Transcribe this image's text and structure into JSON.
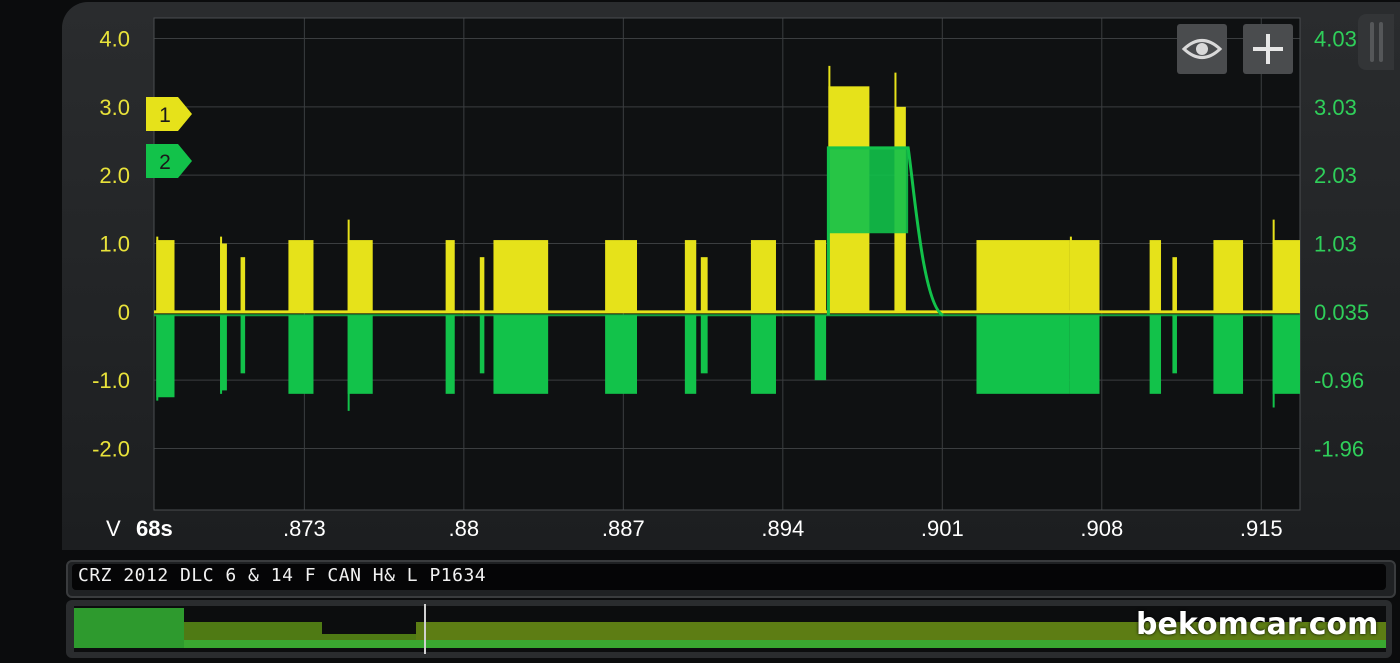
{
  "colors": {
    "channel1": "#e6e21a",
    "channel2": "#12c24a",
    "background": "#0b0c0d",
    "grid": "#3b3e40",
    "axis_text_left": "#e8e23a",
    "axis_text_right": "#2fcf5a",
    "time_text": "#ffffff"
  },
  "toolbar": {
    "view_icon": "eye-icon",
    "add_icon": "plus-icon"
  },
  "markers": {
    "ch1_label": "1",
    "ch2_label": "2"
  },
  "caption": "CRZ 2012 DLC 6 & 14 F CAN H& L P1634",
  "watermark": "bekomcar.com",
  "chart_data": {
    "type": "line",
    "unit_label": "V",
    "time_start_label": "68s",
    "x_ticks": [
      ".873",
      ".88",
      ".887",
      ".894",
      ".901",
      ".908",
      ".915"
    ],
    "x_tick_values": [
      68.873,
      68.88,
      68.887,
      68.894,
      68.901,
      68.908,
      68.915
    ],
    "xlim": [
      68.8664,
      68.9167
    ],
    "y_left_ticks": [
      "4.0",
      "3.0",
      "2.0",
      "1.0",
      "0",
      "-1.0",
      "-2.0"
    ],
    "y_left_values": [
      4.0,
      3.0,
      2.0,
      1.0,
      0,
      -1.0,
      -2.0
    ],
    "y_right_ticks": [
      "4.03",
      "3.03",
      "2.03",
      "1.03",
      "0.035",
      "-0.96",
      "-1.96"
    ],
    "ylim": [
      -2.9,
      4.3
    ],
    "grid": true,
    "series": [
      {
        "name": "1",
        "marker_label": "1",
        "baseline": 0,
        "dominant_level": 1.05,
        "note_level": "bursts from 0 V up to ~1 V, peaks to ~3.6 V near .897",
        "bursts": [
          {
            "t0": 68.8665,
            "t1": 68.8673,
            "high": 1.05,
            "spike": 1.1
          },
          {
            "t0": 68.8693,
            "t1": 68.8696,
            "high": 1.0,
            "spike": 1.1
          },
          {
            "t0": 68.8702,
            "t1": 68.8704,
            "high": 0.8,
            "spike": 0.8
          },
          {
            "t0": 68.8723,
            "t1": 68.8734,
            "high": 1.05,
            "spike": 1.05
          },
          {
            "t0": 68.8749,
            "t1": 68.876,
            "high": 1.05,
            "spike": 1.35
          },
          {
            "t0": 68.8792,
            "t1": 68.8796,
            "high": 1.05,
            "spike": 1.05
          },
          {
            "t0": 68.8807,
            "t1": 68.8809,
            "high": 0.8,
            "spike": 0.8
          },
          {
            "t0": 68.8813,
            "t1": 68.8837,
            "high": 1.05,
            "spike": 1.05
          },
          {
            "t0": 68.8862,
            "t1": 68.8876,
            "high": 1.05,
            "spike": 1.05
          },
          {
            "t0": 68.8897,
            "t1": 68.8902,
            "high": 1.05,
            "spike": 1.05
          },
          {
            "t0": 68.8904,
            "t1": 68.8907,
            "high": 0.8,
            "spike": 0.8
          },
          {
            "t0": 68.8926,
            "t1": 68.8937,
            "high": 1.05,
            "spike": 1.05
          },
          {
            "t0": 68.8954,
            "t1": 68.8959,
            "high": 1.05,
            "spike": 1.05
          },
          {
            "t0": 68.896,
            "t1": 68.8978,
            "high": 3.3,
            "spike": 3.6
          },
          {
            "t0": 68.8989,
            "t1": 68.8994,
            "high": 3.0,
            "spike": 3.5
          },
          {
            "t0": 68.9025,
            "t1": 68.9066,
            "high": 1.05,
            "spike": 1.05
          },
          {
            "t0": 68.9066,
            "t1": 68.9079,
            "high": 1.05,
            "spike": 1.1
          },
          {
            "t0": 68.9101,
            "t1": 68.9106,
            "high": 1.05,
            "spike": 1.05
          },
          {
            "t0": 68.9111,
            "t1": 68.9113,
            "high": 0.8,
            "spike": 0.8
          },
          {
            "t0": 68.9129,
            "t1": 68.9142,
            "high": 1.05,
            "spike": 1.05
          },
          {
            "t0": 68.9155,
            "t1": 68.9167,
            "high": 1.05,
            "spike": 1.35
          }
        ]
      },
      {
        "name": "2",
        "marker_label": "2",
        "baseline": -0.05,
        "dominant_level": -1.2,
        "note_level": "bursts from 0 V down to ~-1.2 V, plateau ~2.4 V near .897-.900",
        "bursts": [
          {
            "t0": 68.8665,
            "t1": 68.8673,
            "low": -1.25,
            "spike": -1.3
          },
          {
            "t0": 68.8693,
            "t1": 68.8696,
            "low": -1.15,
            "spike": -1.2
          },
          {
            "t0": 68.8702,
            "t1": 68.8704,
            "low": -0.9,
            "spike": -0.9
          },
          {
            "t0": 68.8723,
            "t1": 68.8734,
            "low": -1.2,
            "spike": -1.2
          },
          {
            "t0": 68.8749,
            "t1": 68.876,
            "low": -1.2,
            "spike": -1.45
          },
          {
            "t0": 68.8792,
            "t1": 68.8796,
            "low": -1.2,
            "spike": -1.2
          },
          {
            "t0": 68.8807,
            "t1": 68.8809,
            "low": -0.9,
            "spike": -0.9
          },
          {
            "t0": 68.8813,
            "t1": 68.8837,
            "low": -1.2,
            "spike": -1.2
          },
          {
            "t0": 68.8862,
            "t1": 68.8876,
            "low": -1.2,
            "spike": -1.2
          },
          {
            "t0": 68.8897,
            "t1": 68.8902,
            "low": -1.2,
            "spike": -1.2
          },
          {
            "t0": 68.8904,
            "t1": 68.8907,
            "low": -0.9,
            "spike": -0.9
          },
          {
            "t0": 68.8926,
            "t1": 68.8937,
            "low": -1.2,
            "spike": -1.2
          },
          {
            "t0": 68.8954,
            "t1": 68.8959,
            "low": -1.0,
            "spike": -1.0
          },
          {
            "t0": 68.9025,
            "t1": 68.9066,
            "low": -1.2,
            "spike": -1.2
          },
          {
            "t0": 68.9066,
            "t1": 68.9079,
            "low": -1.2,
            "spike": -1.2
          },
          {
            "t0": 68.9101,
            "t1": 68.9106,
            "low": -1.2,
            "spike": -1.2
          },
          {
            "t0": 68.9111,
            "t1": 68.9113,
            "low": -0.9,
            "spike": -0.9
          },
          {
            "t0": 68.9129,
            "t1": 68.9142,
            "low": -1.2,
            "spike": -1.2
          },
          {
            "t0": 68.9155,
            "t1": 68.9167,
            "low": -1.2,
            "spike": -1.4
          }
        ],
        "plateau": {
          "t_rise": 68.896,
          "t_fall_start": 68.8995,
          "t_fall_end": 68.9005,
          "level": 2.4,
          "dip_level": 1.15
        }
      }
    ]
  }
}
